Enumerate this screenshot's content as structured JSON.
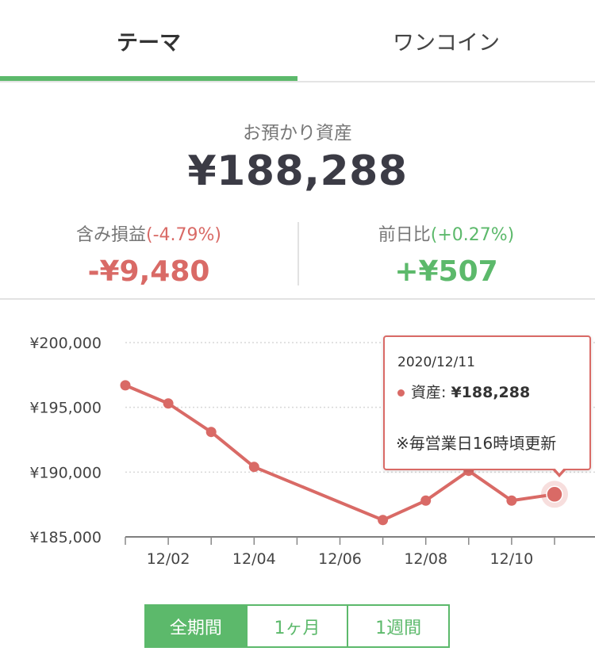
{
  "tabs": [
    {
      "label": "テーマ",
      "active": true
    },
    {
      "label": "ワンコイン",
      "active": false
    }
  ],
  "summary": {
    "label": "お預かり資産",
    "total": "¥188,288",
    "unrealized": {
      "label": "含み損益",
      "pct": "(-4.79%)",
      "value": "-¥9,480"
    },
    "daily": {
      "label": "前日比",
      "pct": "(+0.27%)",
      "value": "+¥507"
    }
  },
  "colors": {
    "accent_green": "#5cb96b",
    "loss_red": "#d96a66"
  },
  "chart_data": {
    "type": "line",
    "x": [
      "2020-12-01",
      "2020-12-02",
      "2020-12-03",
      "2020-12-04",
      "2020-12-07",
      "2020-12-08",
      "2020-12-09",
      "2020-12-10",
      "2020-12-11"
    ],
    "values": [
      196700,
      195300,
      193100,
      190400,
      186300,
      187800,
      190100,
      187800,
      188288
    ],
    "ylim": [
      185000,
      200000
    ],
    "y_ticks": [
      "¥185,000",
      "¥190,000",
      "¥195,000",
      "¥200,000"
    ],
    "x_ticks": [
      "12/02",
      "12/04",
      "12/06",
      "12/08",
      "12/10"
    ],
    "grid": true
  },
  "tooltip": {
    "date": "2020/12/11",
    "label": "資産:",
    "value": "¥188,288",
    "note": "※毎営業日16時頃更新"
  },
  "periods": [
    {
      "label": "全期間",
      "active": true
    },
    {
      "label": "1ヶ月",
      "active": false
    },
    {
      "label": "1週間",
      "active": false
    }
  ]
}
